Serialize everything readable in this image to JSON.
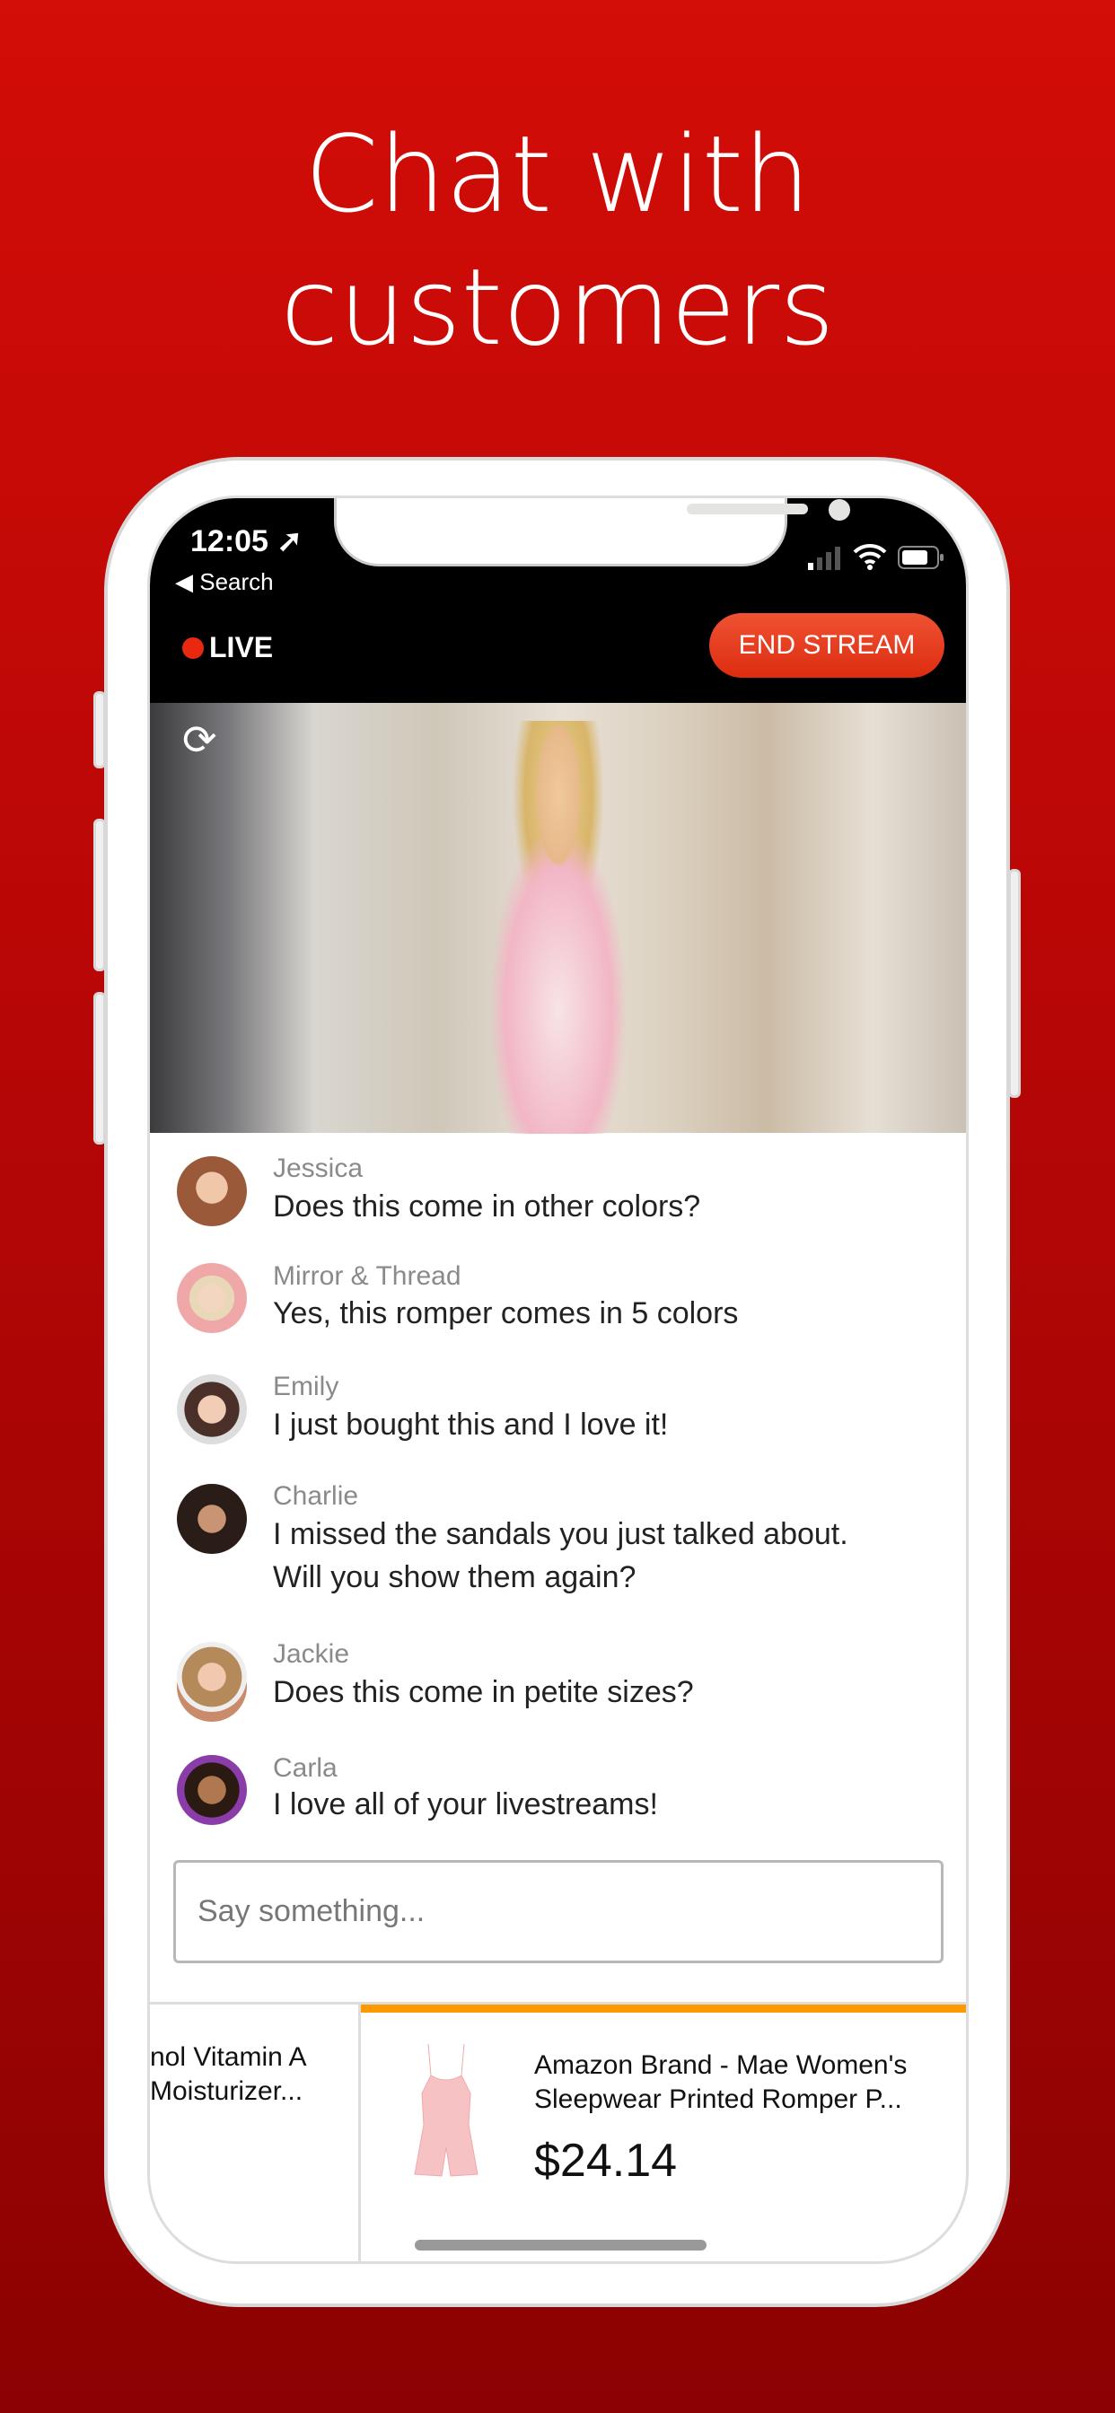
{
  "headline": {
    "line1": "Chat with",
    "line2": "customers"
  },
  "status_bar": {
    "time": "12:05",
    "back_label": "Search"
  },
  "header": {
    "live_label": "LIVE",
    "end_stream_label": "END STREAM"
  },
  "chat": {
    "messages": [
      {
        "name": "Jessica",
        "text": "Does this come in other colors?",
        "avatar_color": "#c98b6a"
      },
      {
        "name": "Mirror & Thread",
        "text": "Yes, this romper comes in 5 colors",
        "avatar_color": "#e9a7a5"
      },
      {
        "name": "Emily",
        "text": "I just bought this and I love it!",
        "avatar_color": "#5a4036"
      },
      {
        "name": "Charlie",
        "text_line1": "I missed the sandals you just talked about.",
        "text_line2": "Will you show them again?",
        "avatar_color": "#3b2a22"
      },
      {
        "name": "Jackie",
        "text": "Does this come in petite sizes?",
        "avatar_color": "#b88a5e"
      },
      {
        "name": "Carla",
        "text": "I love all of your livestreams!",
        "avatar_color": "#8a3ca8"
      }
    ],
    "input_placeholder": "Say something..."
  },
  "products": {
    "previous": {
      "line1": "nol Vitamin A",
      "line2": "Moisturizer..."
    },
    "current": {
      "title_line1": "Amazon Brand - Mae Women's",
      "title_line2": "Sleepwear Printed Romper P...",
      "price": "$24.14"
    },
    "accent_color": "#ff9900"
  }
}
